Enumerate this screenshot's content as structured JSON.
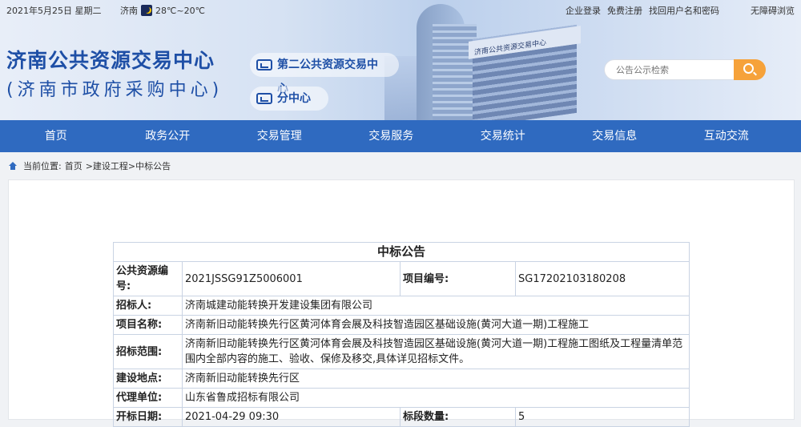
{
  "topbar": {
    "date": "2021年5月25日 星期二",
    "city": "济南",
    "temperature": "28℃~20℃",
    "links": [
      "企业登录",
      "免费注册",
      "找回用户名和密码"
    ],
    "accessibility": "无障碍浏览"
  },
  "header": {
    "title": "济南公共资源交易中心",
    "subtitle": "(济南市政府采购中心)",
    "pill_second_center": "第二公共资源交易中心",
    "pill_branch": "分中心",
    "building_label": "济南公共资源交易中心"
  },
  "search": {
    "placeholder": "公告公示检索"
  },
  "nav": [
    "首页",
    "政务公开",
    "交易管理",
    "交易服务",
    "交易统计",
    "交易信息",
    "互动交流"
  ],
  "breadcrumb": {
    "label": "当前位置:",
    "home": "首页",
    "path": ">建设工程>中标公告"
  },
  "notice": {
    "title": "中标公告",
    "rows": {
      "code_label": "公共资源编号:",
      "code_value": "2021JSSG91Z5006001",
      "project_no_label": "项目编号:",
      "project_no_value": "SG17202103180208",
      "tenderer_label": "招标人:",
      "tenderer_value": "济南城建动能转换开发建设集团有限公司",
      "project_name_label": "项目名称:",
      "project_name_value": "济南新旧动能转换先行区黄河体育会展及科技智造园区基础设施(黄河大道一期)工程施工",
      "scope_label": "招标范围:",
      "scope_value": "济南新旧动能转换先行区黄河体育会展及科技智造园区基础设施(黄河大道一期)工程施工图纸及工程量清单范围内全部内容的施工、验收、保修及移交,具体详见招标文件。",
      "location_label": "建设地点:",
      "location_value": "济南新旧动能转换先行区",
      "agent_label": "代理单位:",
      "agent_value": "山东省鲁成招标有限公司",
      "open_date_label": "开标日期:",
      "open_date_value": "2021-04-29 09:30",
      "sections_label": "标段数量:",
      "sections_value": "5"
    }
  },
  "colors": {
    "nav_bg": "#2f6ac0",
    "title_blue": "#1e4fa6",
    "search_btn": "#f6a23a"
  }
}
